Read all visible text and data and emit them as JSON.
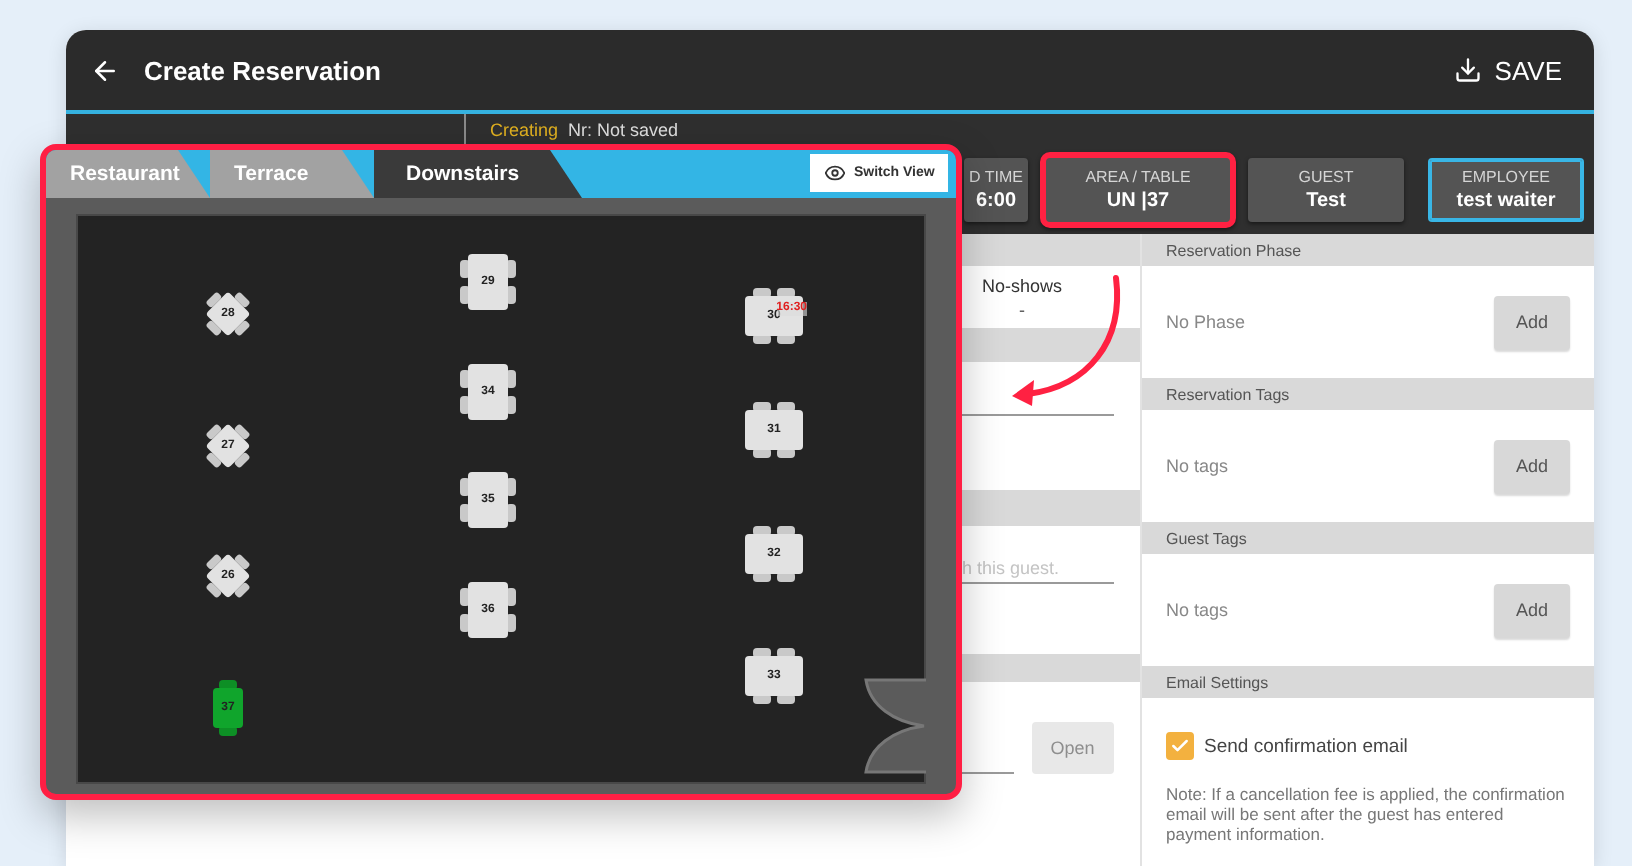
{
  "header": {
    "title": "Create Reservation",
    "save": "SAVE"
  },
  "record": {
    "state": "Creating",
    "number": "Nr: Not saved"
  },
  "summary_tabs": [
    {
      "label": "D TIME",
      "value": "6:00",
      "selected": false,
      "highlighted": false
    },
    {
      "label": "AREA / TABLE",
      "value": "UN |37",
      "selected": false,
      "highlighted": true
    },
    {
      "label": "GUEST",
      "value": "Test",
      "selected": false,
      "highlighted": false
    },
    {
      "label": "EMPLOYEE",
      "value": "test waiter",
      "selected": true,
      "highlighted": false
    }
  ],
  "details": {
    "stat_label": "No-shows",
    "stat_value": "-",
    "note_placeholder": "h this guest.",
    "open_button": {
      "label": "Open",
      "disabled": true
    }
  },
  "side_sections": [
    {
      "kind": "add",
      "title": "Reservation Phase",
      "text": "No Phase",
      "button": "Add"
    },
    {
      "kind": "add",
      "title": "Reservation Tags",
      "text": "No tags",
      "button": "Add"
    },
    {
      "kind": "add",
      "title": "Guest Tags",
      "text": "No tags",
      "button": "Add"
    },
    {
      "kind": "email",
      "title": "Email Settings",
      "checkbox": {
        "label": "Send confirmation email",
        "checked": true
      },
      "note": "Note: If a cancellation fee is applied, the confirmation email will be sent after the guest has entered payment information."
    }
  ],
  "floor_plan": {
    "areas": [
      {
        "label": "Restaurant",
        "selected": false
      },
      {
        "label": "Terrace",
        "selected": false
      },
      {
        "label": "Downstairs",
        "selected": true
      }
    ],
    "switch_view": "Switch View",
    "tables": [
      {
        "number": "28",
        "kind": "diamond",
        "selected": false
      },
      {
        "number": "27",
        "kind": "diamond",
        "selected": false
      },
      {
        "number": "26",
        "kind": "diamond",
        "selected": false
      },
      {
        "number": "37",
        "kind": "single",
        "selected": true
      },
      {
        "number": "29",
        "kind": "tall",
        "selected": false
      },
      {
        "number": "34",
        "kind": "tall",
        "selected": false
      },
      {
        "number": "35",
        "kind": "tall",
        "selected": false
      },
      {
        "number": "36",
        "kind": "tall",
        "selected": false
      },
      {
        "number": "30",
        "kind": "wide",
        "selected": false,
        "time": "16:30"
      },
      {
        "number": "31",
        "kind": "wide",
        "selected": false
      },
      {
        "number": "32",
        "kind": "wide",
        "selected": false
      },
      {
        "number": "33",
        "kind": "wide",
        "selected": false
      }
    ]
  }
}
